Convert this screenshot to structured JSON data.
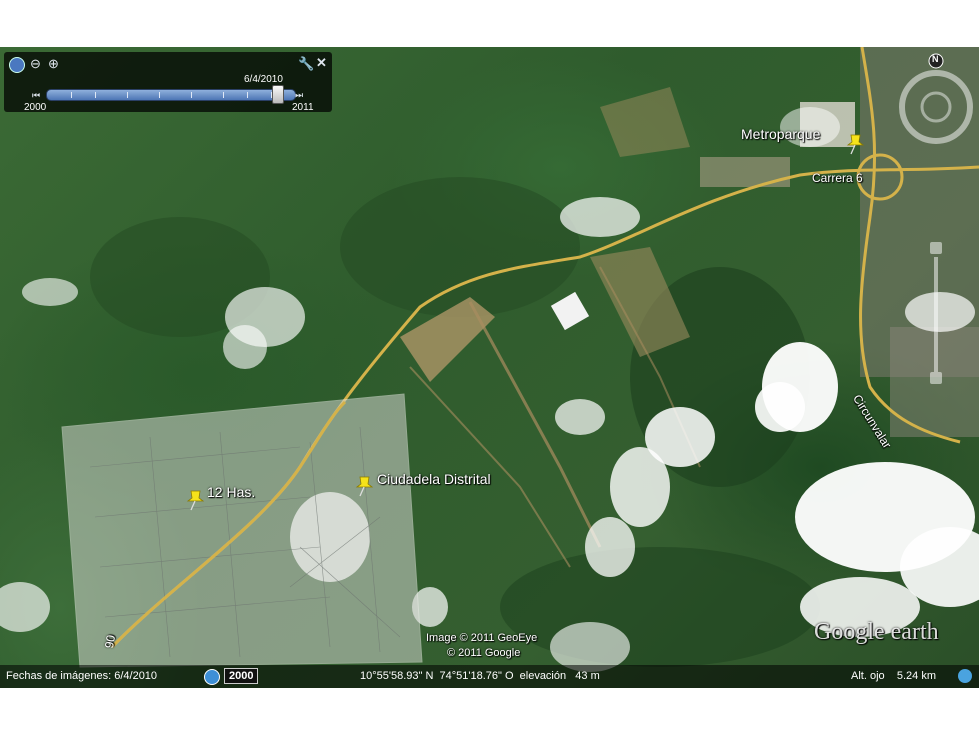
{
  "controls": {
    "date_label": "6/4/2010",
    "start_year": "2000",
    "end_year": "2011",
    "slider_fraction": 0.93,
    "time_icon": "clock-icon",
    "zoom_out_icon": "zoom-out-icon",
    "zoom_in_icon": "zoom-in-icon",
    "settings_icon": "wrench-icon",
    "close_icon": "close-icon",
    "prev_icon": "skip-back-icon",
    "next_icon": "skip-forward-icon"
  },
  "placemarks": {
    "metroparque": "Metroparque",
    "has": "12 Has.",
    "ciudadela": "Ciudadela Distrital"
  },
  "roads": {
    "carrera": "Carrera 6",
    "circunvalar": "Circunvalar",
    "route": "90"
  },
  "attribution": {
    "geoeye": "Image © 2011 GeoEye",
    "google": "© 2011 Google",
    "logo_text": "Google earth"
  },
  "status": {
    "imagery_date": "Fechas de imágenes: 6/4/2010",
    "year_badge": "2000",
    "coords": "10°55'58.93\" N  74°51'18.76\" O  elevación   43 m",
    "eye_alt": "Alt. ojo    5.24 km"
  },
  "compass": {
    "north": "N"
  },
  "colors": {
    "road": "#d4b24a",
    "pin": "#f5e21a",
    "overlay": "#cfd3cc"
  }
}
